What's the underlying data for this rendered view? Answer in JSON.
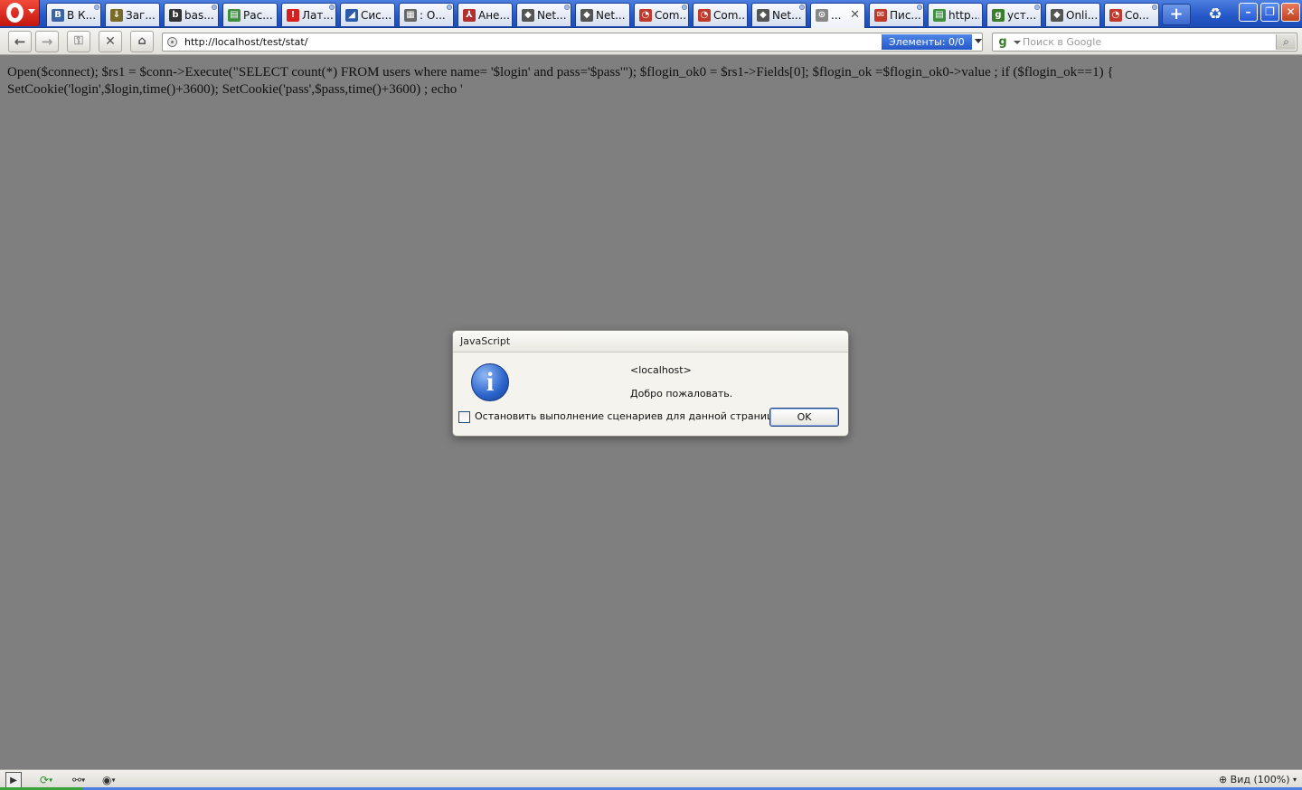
{
  "browser": {
    "tabs": [
      {
        "label": "В К...",
        "icon": "В",
        "icon_color": "#3a63a8"
      },
      {
        "label": "Заг...",
        "icon": "⇓",
        "icon_color": "#7a6a2a"
      },
      {
        "label": "bas...",
        "icon": "b",
        "icon_color": "#333333"
      },
      {
        "label": "Рас...",
        "icon": "▤",
        "icon_color": "#3f8f3f"
      },
      {
        "label": "Лат...",
        "icon": "!",
        "icon_color": "#d81e1e"
      },
      {
        "label": "Сис...",
        "icon": "◢",
        "icon_color": "#2a5aa8"
      },
      {
        "label": ": О...",
        "icon": "▦",
        "icon_color": "#666666"
      },
      {
        "label": "Ане...",
        "icon": "⅄",
        "icon_color": "#b03030"
      },
      {
        "label": "Net...",
        "icon": "◆",
        "icon_color": "#555555"
      },
      {
        "label": "Net...",
        "icon": "◆",
        "icon_color": "#555555"
      },
      {
        "label": "Com...",
        "icon": "◔",
        "icon_color": "#c0392b"
      },
      {
        "label": "Com...",
        "icon": "◔",
        "icon_color": "#c0392b"
      },
      {
        "label": "Net...",
        "icon": "◆",
        "icon_color": "#555555"
      },
      {
        "label": "...",
        "icon": "⊙",
        "icon_color": "#888888",
        "active": true
      },
      {
        "label": "Пис...",
        "icon": "✉",
        "icon_color": "#c0392b"
      },
      {
        "label": "http...",
        "icon": "▤",
        "icon_color": "#3f8f3f"
      },
      {
        "label": "уст...",
        "icon": "g",
        "icon_color": "#3a7d2c"
      },
      {
        "label": "Onli...",
        "icon": "◆",
        "icon_color": "#555555"
      },
      {
        "label": "Co...",
        "icon": "◔",
        "icon_color": "#c0392b"
      }
    ],
    "new_tab_icon": "plus-icon",
    "trash_icon": "trash-icon"
  },
  "toolbar": {
    "address": "http://localhost/test/stat/",
    "elements_label": "Элементы:  0/0",
    "search_placeholder": "Поиск в Google"
  },
  "page": {
    "text": "Open($connect); $rs1 = $conn->Execute(\"SELECT count(*) FROM users where name= '$login' and pass='$pass'\"); $flogin_ok0 = $rs1->Fields[0]; $flogin_ok =$flogin_ok0->value ; if ($flogin_ok==1) { SetCookie('login',$login,time()+3600); SetCookie('pass',$pass,time()+3600) ; echo '"
  },
  "dialog": {
    "title": "JavaScript",
    "origin": "<localhost>",
    "message": "Добро пожаловать.",
    "checkbox_label": "Остановить выполнение сценариев для данной страницы",
    "checkbox_checked": false,
    "ok_label": "OK"
  },
  "statusbar": {
    "zoom_label": "Вид (100%)"
  },
  "colors": {
    "tabbar": "#2457c7",
    "page_background": "#7f7f7f",
    "dialog_background": "#f4f3ee",
    "accent": "#2458c8"
  }
}
